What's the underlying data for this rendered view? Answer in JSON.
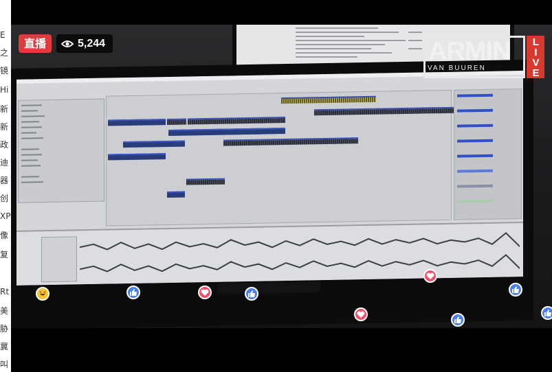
{
  "badge": {
    "live_label": "直播"
  },
  "viewers": {
    "count": "5,244",
    "icon": "eye-icon"
  },
  "watermark": {
    "brand": "ARMIN",
    "sub": "VAN BUUREN",
    "live": "LIVE"
  },
  "reactions": [
    {
      "type": "haha",
      "icon": "haha-emoji-icon"
    },
    {
      "type": "like",
      "icon": "like-reaction-icon"
    },
    {
      "type": "love",
      "icon": "love-reaction-icon"
    },
    {
      "type": "like",
      "icon": "like-reaction-icon"
    },
    {
      "type": "love",
      "icon": "love-reaction-icon"
    },
    {
      "type": "love",
      "icon": "love-reaction-icon"
    },
    {
      "type": "like",
      "icon": "like-reaction-icon"
    },
    {
      "type": "like",
      "icon": "like-reaction-icon"
    },
    {
      "type": "like",
      "icon": "like-reaction-icon"
    }
  ],
  "side_fragments": [
    "E",
    "之",
    "镜",
    "Hi",
    "新",
    "新",
    "政",
    "迪",
    "器",
    "创",
    "XP",
    "像",
    "复",
    "Rt",
    "美",
    "胁",
    "冀",
    "叫"
  ],
  "colors": {
    "live_red": "#e0393e",
    "like_blue": "#4a7ff0",
    "love_pink": "#f0506a",
    "watermark_live": "#d63a2f"
  }
}
